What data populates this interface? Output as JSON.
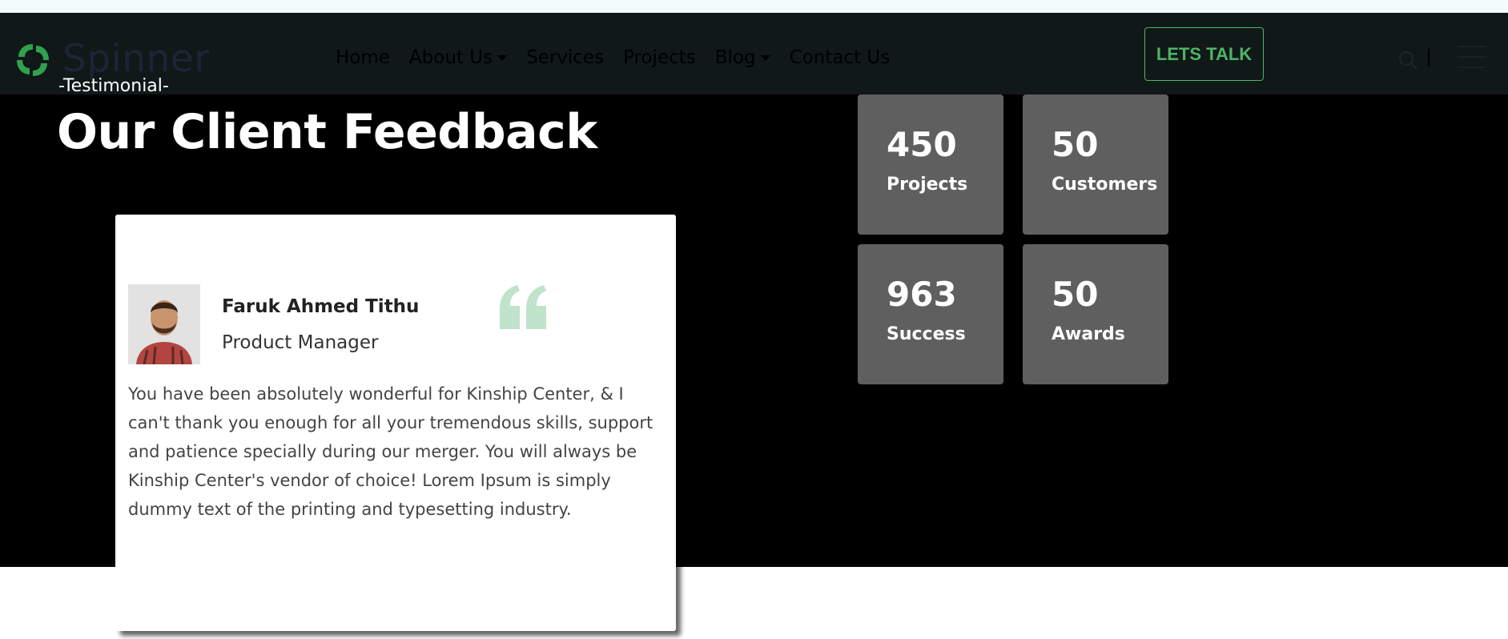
{
  "site": {
    "brand": "Spinner"
  },
  "nav": {
    "items": [
      {
        "label": "Home",
        "dropdown": false
      },
      {
        "label": "About Us",
        "dropdown": true
      },
      {
        "label": "Services",
        "dropdown": false
      },
      {
        "label": "Projects",
        "dropdown": false
      },
      {
        "label": "Blog",
        "dropdown": true
      },
      {
        "label": "Contact Us",
        "dropdown": false
      }
    ],
    "cta_label": "LETS TALK",
    "icons": [
      "search-icon",
      "hamburger-menu-icon"
    ]
  },
  "section": {
    "eyebrow": "-Testimonial-",
    "title": "Our Client Feedback"
  },
  "testimonial": {
    "name": "Faruk Ahmed Tithu",
    "role": "Product Manager",
    "text": "You have been absolutely wonderful for Kinship Center, & I can't thank you enough for all your tremendous skills, support and patience specially during our merger. You will always be Kinship Center's vendor of choice! Lorem Ipsum is simply dummy text of the printing and typesetting industry."
  },
  "stats": [
    {
      "value": "450",
      "label": "Projects"
    },
    {
      "value": "50",
      "label": "Customers"
    },
    {
      "value": "963",
      "label": "Success"
    },
    {
      "value": "50",
      "label": "Awards"
    }
  ],
  "colors": {
    "accent": "#4db567",
    "nav_bg": "#101818",
    "section_bg": "#000000",
    "stat_bg": "#5f5f5f",
    "quote_icon": "#bfe3cb"
  }
}
